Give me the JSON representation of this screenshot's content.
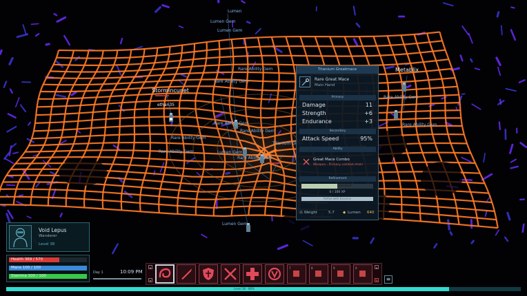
{
  "world_labels": [
    {
      "text": "Lumen"
    },
    {
      "text": "Lumen Gem"
    },
    {
      "text": "Lumen Gem"
    },
    {
      "text": "Rare Ability Gem"
    },
    {
      "text": "Rare Ability Gem"
    },
    {
      "text": "Rare Ability Gem"
    },
    {
      "text": "Rare Ability Gem"
    },
    {
      "text": "Rare Ability Gem"
    },
    {
      "text": "Rare Ability Gem"
    },
    {
      "text": "Lumen Gem"
    },
    {
      "text": "Lumen Gem"
    },
    {
      "text": "Rare Ability Gem"
    },
    {
      "text": "Titanium Great"
    },
    {
      "text": "Rare Ability Gem"
    },
    {
      "text": "Rare Ability Gem"
    }
  ],
  "players": [
    {
      "name": "Stormincunet"
    },
    {
      "name": "Metablix"
    },
    {
      "name": "ethan35"
    }
  ],
  "tooltip": {
    "title": "Titanium Greatmace",
    "item_name": "Rare Great Mace",
    "slot": "Main Hand",
    "primary_header": "Primary",
    "stats": [
      {
        "label": "Damage",
        "value": "11"
      },
      {
        "label": "Strength",
        "value": "+6"
      },
      {
        "label": "Endurance",
        "value": "+3"
      }
    ],
    "secondary_header": "Secondary",
    "secondary": {
      "label": "Attack Speed",
      "value": "95%"
    },
    "ability_header": "Ability",
    "ability_name": "Great Mace Combo",
    "ability_desc": "Weapon - Primary combat chain",
    "refinement_header": "Refinement",
    "refinement_label": "Standard",
    "refinement_fraction": 0.5,
    "xp_text": "0 / 100 XP",
    "refine_button": "Refine with Essence",
    "weight_label": "Weight",
    "weight_value": "5.7",
    "lumen_label": "Lumen",
    "lumen_value": "640",
    "accent": "#e0c060"
  },
  "character": {
    "name": "Void Lepus",
    "class": "Wanderer",
    "level": "Level 38"
  },
  "bars": [
    {
      "label": "Health 369 / 570",
      "fraction": 0.65,
      "color": "#d83a3a"
    },
    {
      "label": "Mana 100 / 100",
      "fraction": 1.0,
      "color": "#3a8ad8"
    },
    {
      "label": "Stamina 100 / 100",
      "fraction": 1.0,
      "color": "#39c84a"
    }
  ],
  "clock": {
    "day": "Day 1",
    "time": "10:09 PM"
  },
  "hotbar": {
    "icons": [
      "swirl-strike-icon",
      "dagger-slash-icon",
      "shield-icon",
      "crossed-swords-icon",
      "cross-plus-icon",
      "target-rune-icon"
    ],
    "empty_slot_numbers": [
      "7",
      "8",
      "9",
      "0"
    ]
  },
  "xp_strip": {
    "fraction": 0.86,
    "label": "Level 38 - 86%"
  }
}
